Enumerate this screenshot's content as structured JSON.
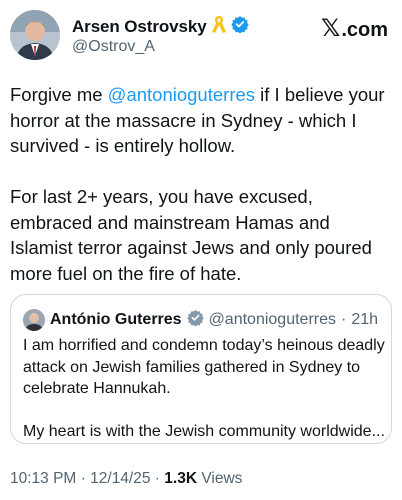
{
  "author": {
    "name": "Arsen Ostrovsky",
    "handle": "@Ostrov_A",
    "ribbon_icon": "yellow-ribbon-icon",
    "verified_icon": "verified-badge-icon"
  },
  "brand": {
    "logo_text": "𝕏",
    "suffix": ".com"
  },
  "post": {
    "p1_before": "Forgive me ",
    "p1_mention": "@antonioguterres",
    "p1_after": " if I believe your horror at the massacre in Sydney - which I survived - is entirely hollow.",
    "p2": "For last 2+ years, you have excused, embraced and mainstream Hamas and Islamist terror against Jews and only poured more fuel on the fire of hate."
  },
  "quoted": {
    "name": "António Guterres",
    "handle": "@antonioguterres",
    "separator": "·",
    "time": "21h",
    "p1": "I am horrified and condemn today’s heinous deadly attack on Jewish families gathered in Sydney to celebrate Hannukah.",
    "p2": "My heart is with the Jewish community worldwide..."
  },
  "meta": {
    "time": "10:13 PM",
    "sep1": " · ",
    "date": "12/14/25",
    "sep2": " · ",
    "views_count": "1.3K",
    "views_label": " Views"
  },
  "colors": {
    "accent": "#1d9bf0",
    "ribbon": "#f4c21a",
    "secondary_text": "#536471"
  }
}
